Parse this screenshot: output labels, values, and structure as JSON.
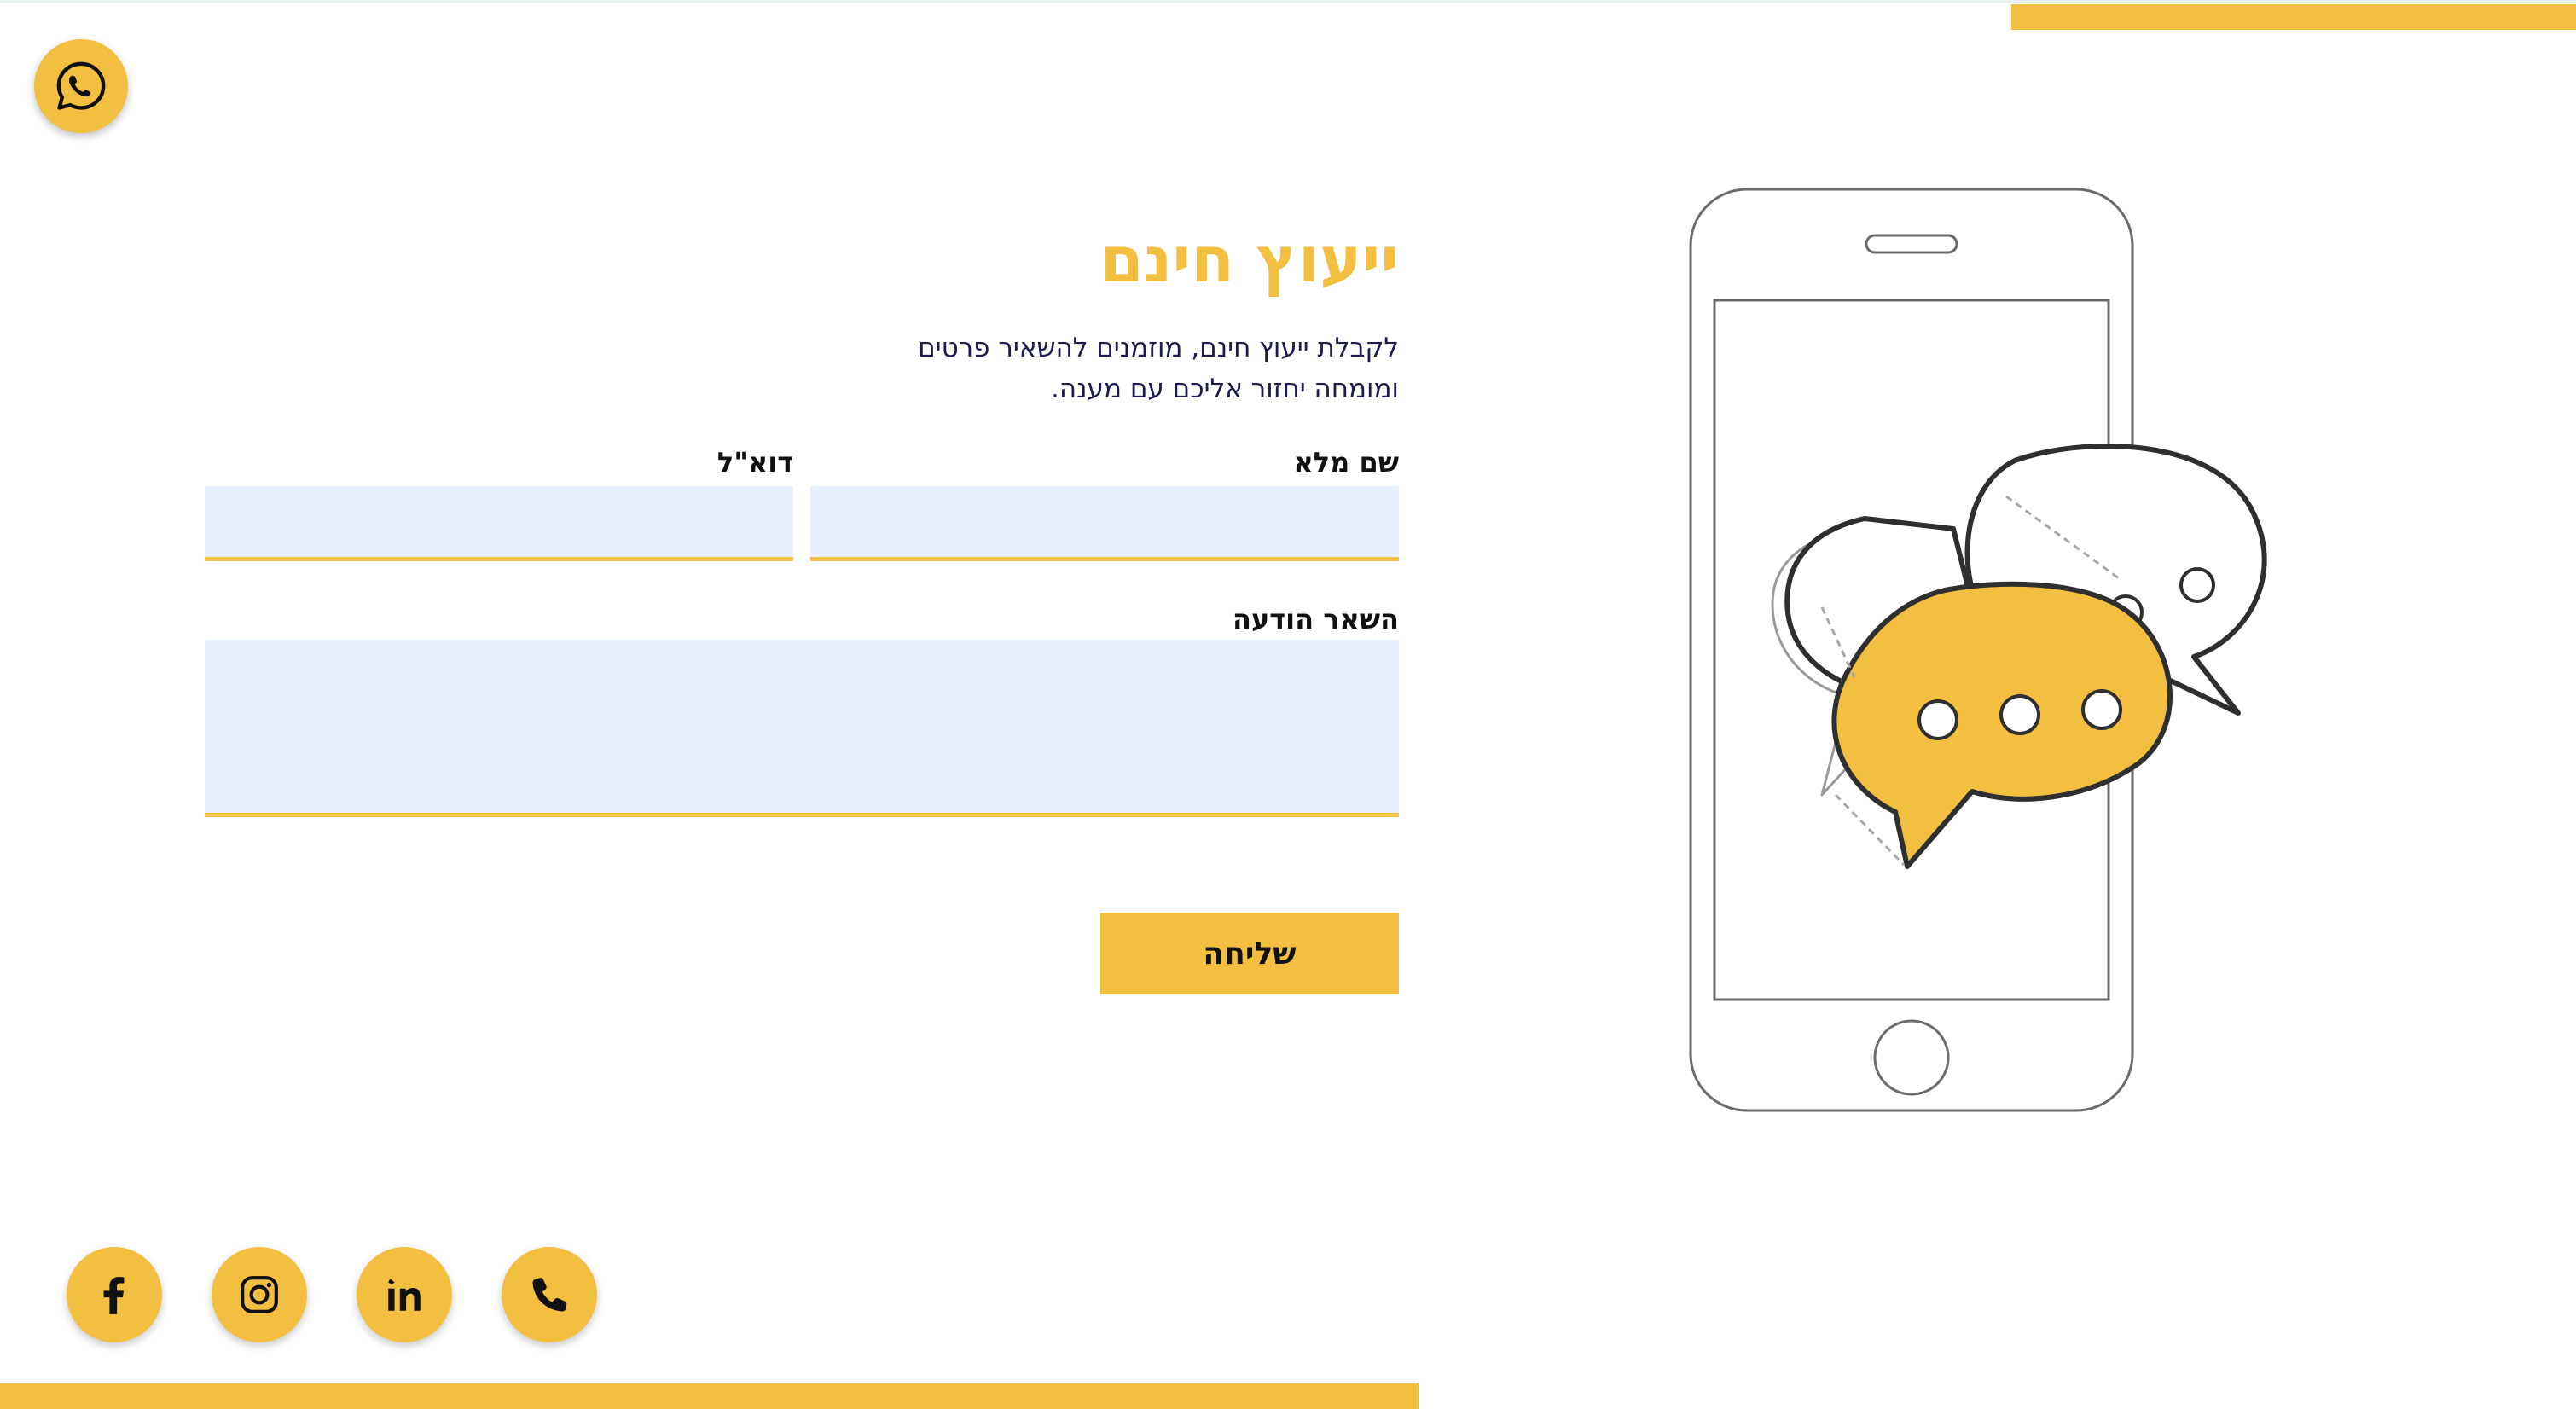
{
  "contact_form": {
    "title": "ייעוץ חינם",
    "intro_lines": [
      "לקבלת ייעוץ חינם, מוזמנים להשאיר פרטים",
      "ומומחה יחזור אליכם עם מענה."
    ],
    "full_name_label": "שם מלא",
    "full_name_value": "",
    "email_label": "דוא\"ל",
    "email_value": "",
    "message_label": "השאר הודעה",
    "message_value": "",
    "submit_label": "שליחה"
  },
  "floating_buttons": {
    "whatsapp_icon": "whatsapp-icon"
  },
  "social_links": [
    {
      "icon": "facebook-icon"
    },
    {
      "icon": "instagram-icon"
    },
    {
      "icon": "linkedin-icon"
    },
    {
      "icon": "phone-icon"
    }
  ],
  "illustration": {
    "icon": "smartphone-chat-bubbles-illustration"
  },
  "colors": {
    "accent": "#f2bf40",
    "input_background": "#e8effd",
    "intro_text": "#1c1b4f",
    "label_text": "#111111"
  }
}
